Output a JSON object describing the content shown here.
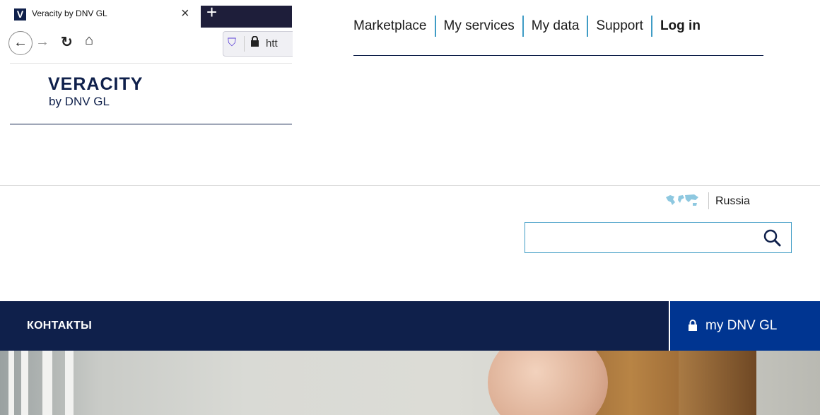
{
  "browser": {
    "tab_title": "Veracity by DNV GL",
    "favicon_letter": "V",
    "close_glyph": "×",
    "new_tab_glyph": "+",
    "url_partial": "htt",
    "icons": [
      "back-arrow-icon",
      "forward-arrow-icon",
      "reload-icon",
      "home-icon",
      "shield-icon",
      "lock-icon"
    ]
  },
  "veracity_logo": {
    "title": "VERACITY",
    "subtitle": "by DNV GL"
  },
  "top_nav": {
    "items": [
      {
        "label": "Marketplace"
      },
      {
        "label": "My services"
      },
      {
        "label": "My data"
      },
      {
        "label": "Support"
      },
      {
        "label": "Log in"
      }
    ],
    "accent_color": "#3f9cc5"
  },
  "locale": {
    "region": "Russia",
    "icon": "world-map-icon"
  },
  "search": {
    "value": "",
    "placeholder": "",
    "icon": "search-icon"
  },
  "main_nav": {
    "contacts_label": "КОНТАКТЫ",
    "my_dnv_label": "my DNV GL",
    "background_color": "#0f204b",
    "my_dnv_color": "#003591"
  }
}
